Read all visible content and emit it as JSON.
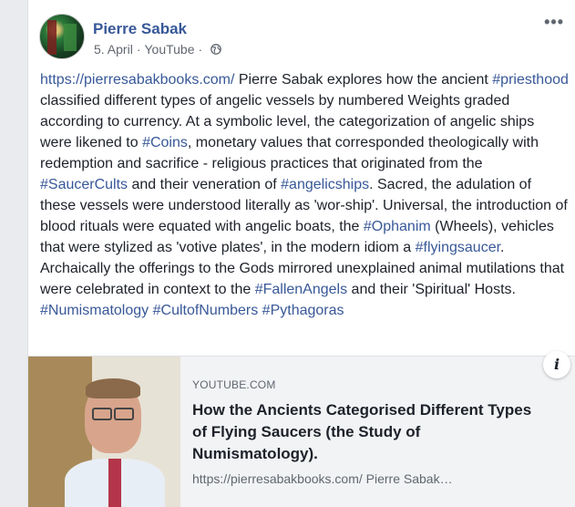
{
  "post": {
    "author": "Pierre Sabak",
    "date": "5. April",
    "separator": "·",
    "source": "YouTube",
    "separator2": "·",
    "more_glyph": "•••",
    "text_segments": [
      {
        "text": "https://pierresabakbooks.com/",
        "link": true
      },
      {
        "text": " Pierre Sabak explores how the ancient ",
        "link": false
      },
      {
        "text": "#priesthood",
        "link": true
      },
      {
        "text": " classified different types of angelic vessels by numbered Weights graded according to currency. At a symbolic level, the categorization of angelic ships were likened to ",
        "link": false
      },
      {
        "text": "#Coins",
        "link": true
      },
      {
        "text": ", monetary values that corresponded theologically with redemption and sacrifice - religious practices that originated from the ",
        "link": false
      },
      {
        "text": "#SaucerCults",
        "link": true
      },
      {
        "text": " and their veneration of ",
        "link": false
      },
      {
        "text": "#angelicships",
        "link": true
      },
      {
        "text": ". Sacred, the adulation of these vessels were understood literally as 'wor-ship'. Universal, the introduction of blood rituals were equated with angelic boats, the ",
        "link": false
      },
      {
        "text": "#Ophanim",
        "link": true
      },
      {
        "text": " (Wheels), vehicles that were stylized as 'votive plates', in the modern idiom a ",
        "link": false
      },
      {
        "text": "#flyingsaucer",
        "link": true
      },
      {
        "text": ". Archaically the offerings to the Gods mirrored unexplained animal mutilations that were celebrated in context to the ",
        "link": false
      },
      {
        "text": "#FallenAngels",
        "link": true
      },
      {
        "text": " and their 'Spiritual' Hosts. ",
        "link": false
      },
      {
        "text": "#Numismatology",
        "link": true
      },
      {
        "text": " ",
        "link": false
      },
      {
        "text": "#CultofNumbers",
        "link": true
      },
      {
        "text": " ",
        "link": false
      },
      {
        "text": "#Pythagoras",
        "link": true
      }
    ]
  },
  "link_preview": {
    "domain": "YOUTUBE.COM",
    "title": "How the Ancients Categorised Different Types of Flying Saucers (the Study of Numismatology).",
    "description": "https://pierresabakbooks.com/ Pierre Sabak…",
    "info_glyph": "i"
  },
  "icons": {
    "avatar": "avatar-image",
    "audience": "globe-icon",
    "more": "more-options-icon",
    "info": "info-icon"
  },
  "colors": {
    "link": "#385898",
    "text": "#1d2129",
    "meta": "#616770",
    "preview_bg": "#f2f3f5"
  }
}
